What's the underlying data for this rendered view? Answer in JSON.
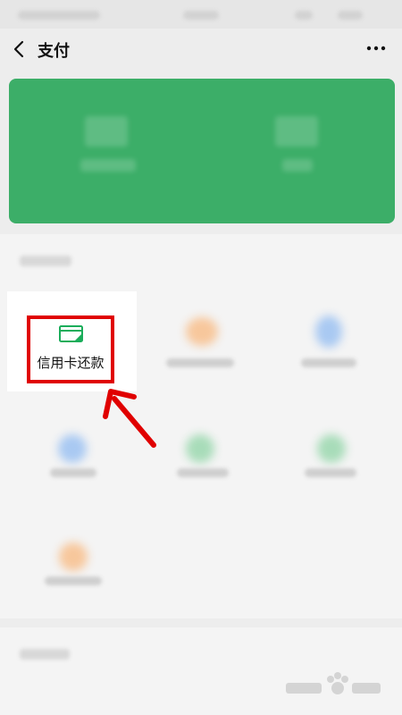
{
  "header": {
    "title": "支付",
    "back_icon": "chevron-left-icon",
    "more_icon": "more-horizontal-icon"
  },
  "services": {
    "credit_card_repay": {
      "label": "信用卡还款",
      "icon": "credit-card-icon",
      "accent": "#1aad5a"
    }
  },
  "annotation": {
    "highlight_color": "#e00000",
    "arrow_color": "#e00000"
  },
  "colors": {
    "wallet_card": "#3cae68",
    "background": "#ededed"
  }
}
